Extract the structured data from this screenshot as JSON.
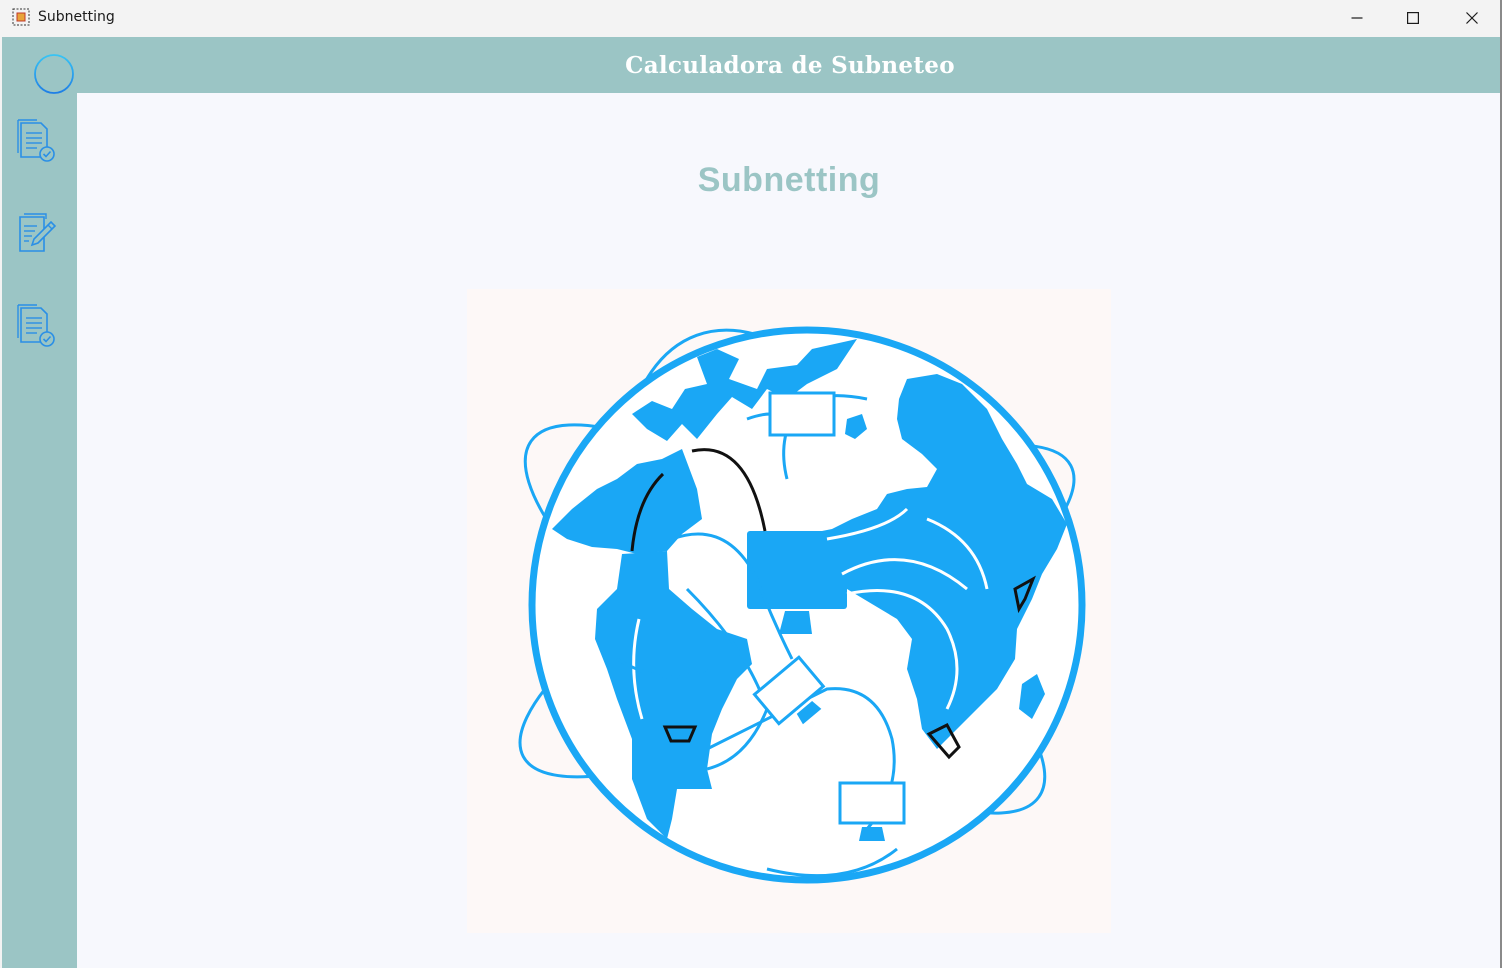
{
  "window": {
    "title": "Subnetting",
    "icon": "app-icon",
    "controls": [
      "minimize-icon",
      "maximize-icon",
      "close-icon"
    ]
  },
  "header": {
    "title": "Calculadora de Subneteo"
  },
  "sidebar": {
    "menu_icon": "hamburger-menu-icon",
    "items": [
      {
        "icon": "document-check-icon"
      },
      {
        "icon": "document-edit-icon"
      },
      {
        "icon": "document-check-icon"
      }
    ]
  },
  "main": {
    "title": "Subnetting",
    "illustration": "globe-network-icon"
  },
  "colors": {
    "accent": "#9bc5c5",
    "icon_blue": "#1aa7f5",
    "background": "#f7f8fd",
    "header_text": "#ffffff"
  }
}
